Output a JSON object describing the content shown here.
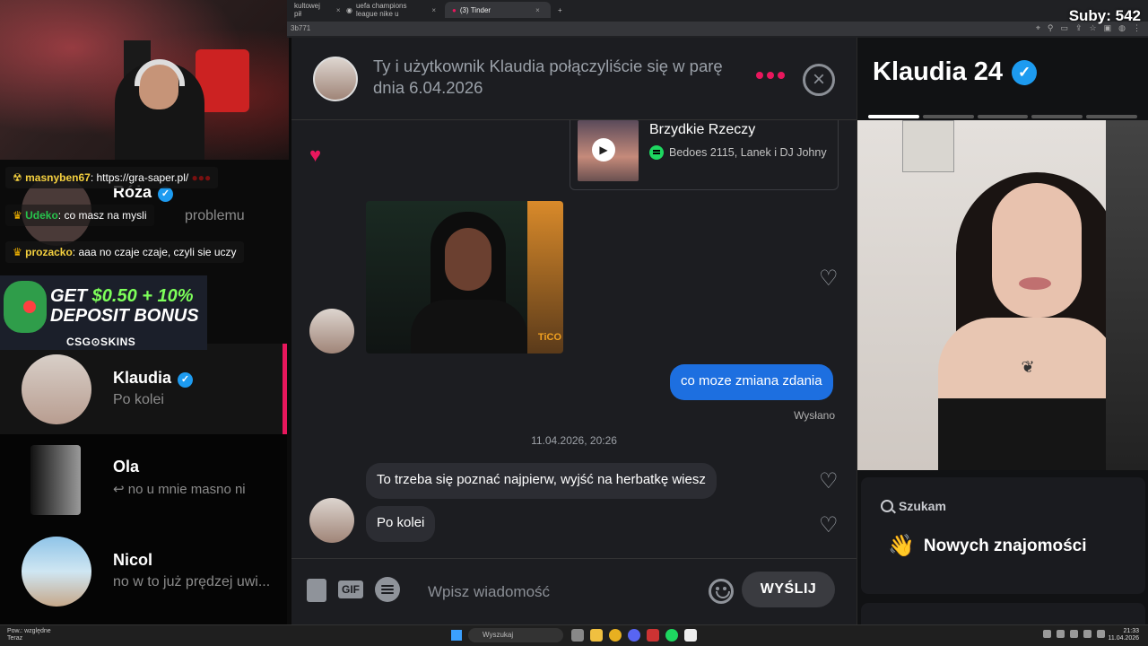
{
  "browser": {
    "tabs": [
      {
        "label": "kultowej pił",
        "active": false
      },
      {
        "label": "uefa champions league nike u",
        "active": false
      },
      {
        "label": "(3) Tinder",
        "active": true
      }
    ],
    "url_fragment": "3b771",
    "new_tab": "+"
  },
  "stream": {
    "subs": "Suby: 542"
  },
  "chat_overlay": [
    {
      "user": "masnyben67",
      "text": ": https://gra-saper.pl/",
      "user_color": "#f4d03f"
    },
    {
      "user": "Udeko",
      "text": ": co masz na mysli",
      "user_color": "#27c24c"
    },
    {
      "user": "prozacko",
      "text": ": aaa no czaje czaje, czyli sie uczy",
      "user_color": "#f4d03f"
    }
  ],
  "ad": {
    "line1_prefix": "GET ",
    "line1_amount": "$0.50 + 10%",
    "line2": "DEPOSIT BONUS",
    "brand": "CSG⊙SKINS"
  },
  "matches": [
    {
      "name": "Róża",
      "message": "problemu",
      "verified": true
    },
    {
      "name": "Klaudia",
      "message": "Po kolei",
      "verified": true,
      "active": true
    },
    {
      "name": "Ola",
      "message": "↩ no u mnie masno ni",
      "verified": false
    },
    {
      "name": "Nicol",
      "message": "no w to już prędzej uwi...",
      "verified": false
    }
  ],
  "chat": {
    "header_title": "Ty i użytkownik Klaudia połączyliście się w parę dnia 6.04.2026",
    "close_symbol": "×",
    "spotify": {
      "song": "Brzydkie Rzeczy",
      "artists": "Bedoes 2115, Lanek i DJ Johny",
      "play_symbol": "▶"
    },
    "photo_watermark": "TiCO",
    "outgoing_message": "co moze zmiana zdania",
    "sent_status": "Wysłano",
    "date_separator": "11.04.2026, 20:26",
    "incoming_messages": [
      "To trzeba się poznać najpierw, wyjść na herbatkę wiesz",
      "Po kolei"
    ],
    "composer": {
      "gif_label": "GIF",
      "placeholder": "Wpisz wiadomość",
      "send_label": "WYŚLIJ"
    }
  },
  "profile": {
    "name_age": "Klaudia 24",
    "photo_count": 5,
    "current_photo": 1,
    "looking_for_label": "Szukam",
    "looking_for_value": "Nowych znajomości",
    "wave_emoji": "👋"
  },
  "taskbar": {
    "weather_line1": "Pow.: względne",
    "weather_line2": "Teraz",
    "search_label": "Wyszukaj",
    "time": "21:33",
    "date": "11.04.2026"
  },
  "colors": {
    "tinder_accent": "#e8175d",
    "message_blue": "#1d6fe0",
    "verified_blue": "#1d9bf0",
    "spotify_green": "#1ed760"
  }
}
